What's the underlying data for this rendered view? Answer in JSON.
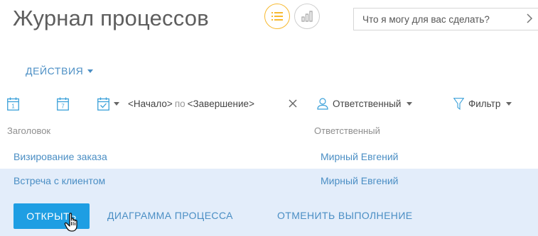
{
  "header": {
    "title": "Журнал процессов",
    "views": [
      {
        "name": "list-view",
        "icon": "list-icon",
        "active": true,
        "accent": "#f7b92f"
      },
      {
        "name": "chart-view",
        "icon": "chart-icon",
        "active": false
      }
    ],
    "search_placeholder": "Что я могу для вас сделать?",
    "search_icon": "chevron-right-icon"
  },
  "actions": {
    "label": "ДЕЙСТВИЯ",
    "icon": "chevron-down-icon"
  },
  "filters": {
    "day_icon_label": "1",
    "week_icon_label": "7",
    "custom_period_icon": "calendar-check-icon",
    "period_start": "<Начало>",
    "period_sep": "по",
    "period_end": "<Завершение>",
    "clear_icon": "close-icon",
    "owner_label": "Ответственный",
    "owner_icon": "user-icon",
    "filter_label": "Фильтр",
    "filter_icon": "funnel-icon"
  },
  "table": {
    "columns": [
      "Заголовок",
      "Ответственный"
    ],
    "rows": [
      {
        "title": "Визирование заказа",
        "owner": "Мирный Евгений",
        "selected": false
      },
      {
        "title": "Встреча с клиентом",
        "owner": "Мирный Евгений",
        "selected": true
      }
    ]
  },
  "row_actions": {
    "open_label": "ОТКРЫТЬ",
    "diagram_label": "ДИАГРАММА ПРОЦЕССА",
    "cancel_label": "ОТМЕНИТЬ ВЫПОЛНЕНИЕ"
  },
  "colors": {
    "accent": "#1e9ee3",
    "link": "#4a8ec4",
    "selected_row": "#e3edfa",
    "view_active": "#f7b92f"
  }
}
